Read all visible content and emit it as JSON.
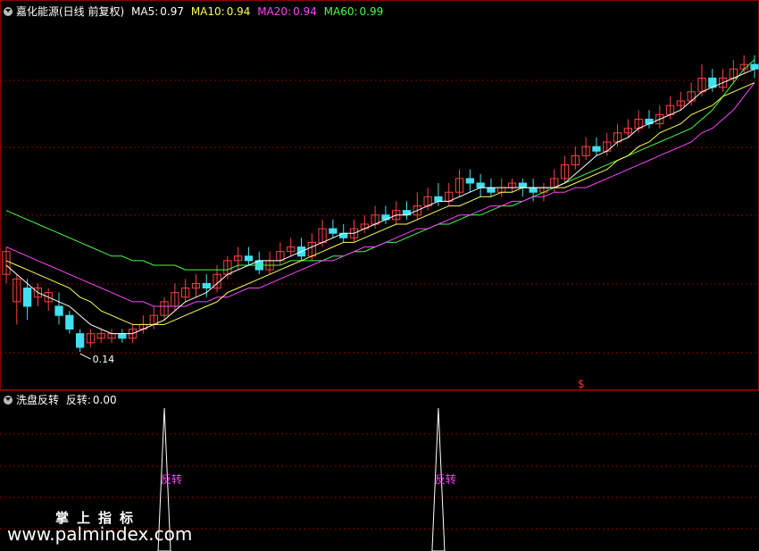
{
  "header": {
    "title": "嘉化能源(日线 前复权)",
    "ma": [
      {
        "label": "MA5:",
        "value": "0.97",
        "color": "#ffffff"
      },
      {
        "label": "MA10:",
        "value": "0.94",
        "color": "#ffff55"
      },
      {
        "label": "MA20:",
        "value": "0.94",
        "color": "#ff44ff"
      },
      {
        "label": "MA60:",
        "value": "0.99",
        "color": "#44ff44"
      }
    ]
  },
  "sub_header": {
    "name": "洗盘反转",
    "label": "反转:",
    "value": "0.00"
  },
  "watermark": {
    "line1": "掌上指标",
    "line2": "www.palmindex.com"
  },
  "colors": {
    "up": "#ff4040",
    "down": "#40e0f0",
    "grid": "#8b0000",
    "ma5": "#ffffff",
    "ma10": "#ffff55",
    "ma20": "#ff44ff",
    "ma60": "#44ff44",
    "signal": "#ff44ff"
  },
  "chart_data": {
    "type": "candlestick",
    "low_annotation": "0.14",
    "marker_symbol": "$",
    "signal_text": "反转",
    "signal_spike_bars": [
      15,
      41
    ],
    "candles": [
      [
        0.52,
        0.57,
        0.58,
        0.5
      ],
      [
        0.46,
        0.51,
        0.52,
        0.41
      ],
      [
        0.49,
        0.45,
        0.51,
        0.42
      ],
      [
        0.47,
        0.49,
        0.5,
        0.45
      ],
      [
        0.46,
        0.48,
        0.49,
        0.44
      ],
      [
        0.45,
        0.43,
        0.48,
        0.41
      ],
      [
        0.43,
        0.4,
        0.44,
        0.39
      ],
      [
        0.39,
        0.36,
        0.4,
        0.35
      ],
      [
        0.37,
        0.39,
        0.4,
        0.36
      ],
      [
        0.38,
        0.39,
        0.4,
        0.37
      ],
      [
        0.38,
        0.39,
        0.4,
        0.37
      ],
      [
        0.39,
        0.38,
        0.4,
        0.37
      ],
      [
        0.38,
        0.4,
        0.41,
        0.37
      ],
      [
        0.4,
        0.41,
        0.43,
        0.39
      ],
      [
        0.41,
        0.43,
        0.45,
        0.4
      ],
      [
        0.43,
        0.46,
        0.47,
        0.42
      ],
      [
        0.45,
        0.48,
        0.5,
        0.44
      ],
      [
        0.47,
        0.49,
        0.51,
        0.46
      ],
      [
        0.49,
        0.5,
        0.52,
        0.47
      ],
      [
        0.5,
        0.49,
        0.52,
        0.47
      ],
      [
        0.49,
        0.52,
        0.54,
        0.48
      ],
      [
        0.52,
        0.55,
        0.56,
        0.51
      ],
      [
        0.55,
        0.56,
        0.58,
        0.53
      ],
      [
        0.56,
        0.55,
        0.58,
        0.54
      ],
      [
        0.55,
        0.53,
        0.57,
        0.52
      ],
      [
        0.53,
        0.55,
        0.57,
        0.52
      ],
      [
        0.55,
        0.57,
        0.59,
        0.54
      ],
      [
        0.57,
        0.58,
        0.6,
        0.56
      ],
      [
        0.58,
        0.56,
        0.6,
        0.55
      ],
      [
        0.56,
        0.59,
        0.61,
        0.55
      ],
      [
        0.59,
        0.62,
        0.64,
        0.58
      ],
      [
        0.62,
        0.61,
        0.64,
        0.6
      ],
      [
        0.61,
        0.6,
        0.63,
        0.59
      ],
      [
        0.6,
        0.62,
        0.64,
        0.59
      ],
      [
        0.62,
        0.63,
        0.65,
        0.61
      ],
      [
        0.63,
        0.65,
        0.67,
        0.62
      ],
      [
        0.65,
        0.64,
        0.67,
        0.63
      ],
      [
        0.64,
        0.66,
        0.68,
        0.63
      ],
      [
        0.66,
        0.65,
        0.68,
        0.64
      ],
      [
        0.65,
        0.67,
        0.7,
        0.64
      ],
      [
        0.67,
        0.69,
        0.71,
        0.66
      ],
      [
        0.69,
        0.68,
        0.72,
        0.67
      ],
      [
        0.68,
        0.7,
        0.72,
        0.67
      ],
      [
        0.7,
        0.73,
        0.75,
        0.69
      ],
      [
        0.73,
        0.72,
        0.75,
        0.7
      ],
      [
        0.72,
        0.71,
        0.74,
        0.69
      ],
      [
        0.71,
        0.7,
        0.73,
        0.69
      ],
      [
        0.7,
        0.71,
        0.73,
        0.69
      ],
      [
        0.71,
        0.72,
        0.73,
        0.7
      ],
      [
        0.72,
        0.71,
        0.73,
        0.69
      ],
      [
        0.71,
        0.7,
        0.73,
        0.68
      ],
      [
        0.7,
        0.71,
        0.72,
        0.68
      ],
      [
        0.71,
        0.73,
        0.75,
        0.7
      ],
      [
        0.73,
        0.76,
        0.78,
        0.72
      ],
      [
        0.76,
        0.78,
        0.8,
        0.75
      ],
      [
        0.78,
        0.8,
        0.82,
        0.77
      ],
      [
        0.8,
        0.79,
        0.82,
        0.78
      ],
      [
        0.79,
        0.81,
        0.83,
        0.78
      ],
      [
        0.81,
        0.83,
        0.85,
        0.8
      ],
      [
        0.83,
        0.84,
        0.86,
        0.82
      ],
      [
        0.84,
        0.86,
        0.88,
        0.83
      ],
      [
        0.86,
        0.85,
        0.88,
        0.84
      ],
      [
        0.85,
        0.87,
        0.89,
        0.84
      ],
      [
        0.87,
        0.89,
        0.91,
        0.86
      ],
      [
        0.89,
        0.9,
        0.92,
        0.88
      ],
      [
        0.9,
        0.92,
        0.94,
        0.89
      ],
      [
        0.92,
        0.95,
        0.98,
        0.91
      ],
      [
        0.95,
        0.93,
        0.97,
        0.92
      ],
      [
        0.93,
        0.95,
        0.97,
        0.92
      ],
      [
        0.95,
        0.97,
        0.99,
        0.94
      ],
      [
        0.97,
        0.98,
        1.0,
        0.96
      ],
      [
        0.98,
        0.97,
        1.0,
        0.95
      ]
    ],
    "ma5": [
      0.54,
      0.52,
      0.5,
      0.48,
      0.47,
      0.46,
      0.45,
      0.43,
      0.41,
      0.4,
      0.39,
      0.39,
      0.39,
      0.4,
      0.41,
      0.42,
      0.44,
      0.46,
      0.47,
      0.48,
      0.5,
      0.52,
      0.53,
      0.54,
      0.55,
      0.55,
      0.55,
      0.56,
      0.57,
      0.58,
      0.59,
      0.6,
      0.61,
      0.61,
      0.62,
      0.63,
      0.64,
      0.65,
      0.65,
      0.66,
      0.67,
      0.68,
      0.68,
      0.69,
      0.7,
      0.71,
      0.71,
      0.71,
      0.71,
      0.71,
      0.71,
      0.71,
      0.71,
      0.72,
      0.74,
      0.76,
      0.78,
      0.79,
      0.81,
      0.82,
      0.84,
      0.85,
      0.86,
      0.87,
      0.88,
      0.9,
      0.92,
      0.93,
      0.94,
      0.95,
      0.96,
      0.97
    ],
    "ma10": [
      0.55,
      0.54,
      0.53,
      0.52,
      0.51,
      0.5,
      0.49,
      0.47,
      0.46,
      0.44,
      0.43,
      0.42,
      0.41,
      0.41,
      0.41,
      0.41,
      0.42,
      0.43,
      0.44,
      0.45,
      0.46,
      0.48,
      0.49,
      0.5,
      0.51,
      0.52,
      0.53,
      0.54,
      0.55,
      0.56,
      0.57,
      0.58,
      0.59,
      0.59,
      0.6,
      0.61,
      0.62,
      0.63,
      0.63,
      0.64,
      0.65,
      0.66,
      0.67,
      0.67,
      0.68,
      0.69,
      0.69,
      0.7,
      0.7,
      0.71,
      0.71,
      0.71,
      0.71,
      0.71,
      0.72,
      0.73,
      0.74,
      0.75,
      0.77,
      0.78,
      0.8,
      0.81,
      0.83,
      0.84,
      0.85,
      0.87,
      0.88,
      0.89,
      0.91,
      0.92,
      0.93,
      0.94
    ],
    "ma20": [
      0.58,
      0.57,
      0.56,
      0.55,
      0.54,
      0.53,
      0.52,
      0.51,
      0.5,
      0.49,
      0.48,
      0.47,
      0.46,
      0.46,
      0.45,
      0.45,
      0.45,
      0.45,
      0.46,
      0.46,
      0.47,
      0.47,
      0.48,
      0.49,
      0.49,
      0.5,
      0.51,
      0.52,
      0.53,
      0.54,
      0.55,
      0.55,
      0.56,
      0.57,
      0.58,
      0.58,
      0.59,
      0.6,
      0.61,
      0.62,
      0.62,
      0.63,
      0.64,
      0.65,
      0.65,
      0.66,
      0.67,
      0.67,
      0.68,
      0.68,
      0.69,
      0.69,
      0.7,
      0.7,
      0.71,
      0.71,
      0.72,
      0.73,
      0.74,
      0.75,
      0.76,
      0.77,
      0.78,
      0.79,
      0.8,
      0.81,
      0.83,
      0.84,
      0.86,
      0.88,
      0.91,
      0.94
    ],
    "ma60": [
      0.66,
      0.65,
      0.64,
      0.63,
      0.62,
      0.61,
      0.6,
      0.59,
      0.58,
      0.57,
      0.56,
      0.56,
      0.55,
      0.55,
      0.54,
      0.54,
      0.54,
      0.53,
      0.53,
      0.53,
      0.53,
      0.53,
      0.54,
      0.54,
      0.54,
      0.54,
      0.54,
      0.55,
      0.55,
      0.55,
      0.55,
      0.56,
      0.56,
      0.57,
      0.57,
      0.58,
      0.59,
      0.59,
      0.6,
      0.61,
      0.62,
      0.63,
      0.63,
      0.64,
      0.65,
      0.65,
      0.66,
      0.67,
      0.67,
      0.68,
      0.69,
      0.7,
      0.71,
      0.72,
      0.73,
      0.74,
      0.75,
      0.76,
      0.77,
      0.78,
      0.79,
      0.8,
      0.81,
      0.82,
      0.83,
      0.84,
      0.86,
      0.88,
      0.91,
      0.94,
      0.97,
      0.99
    ]
  }
}
